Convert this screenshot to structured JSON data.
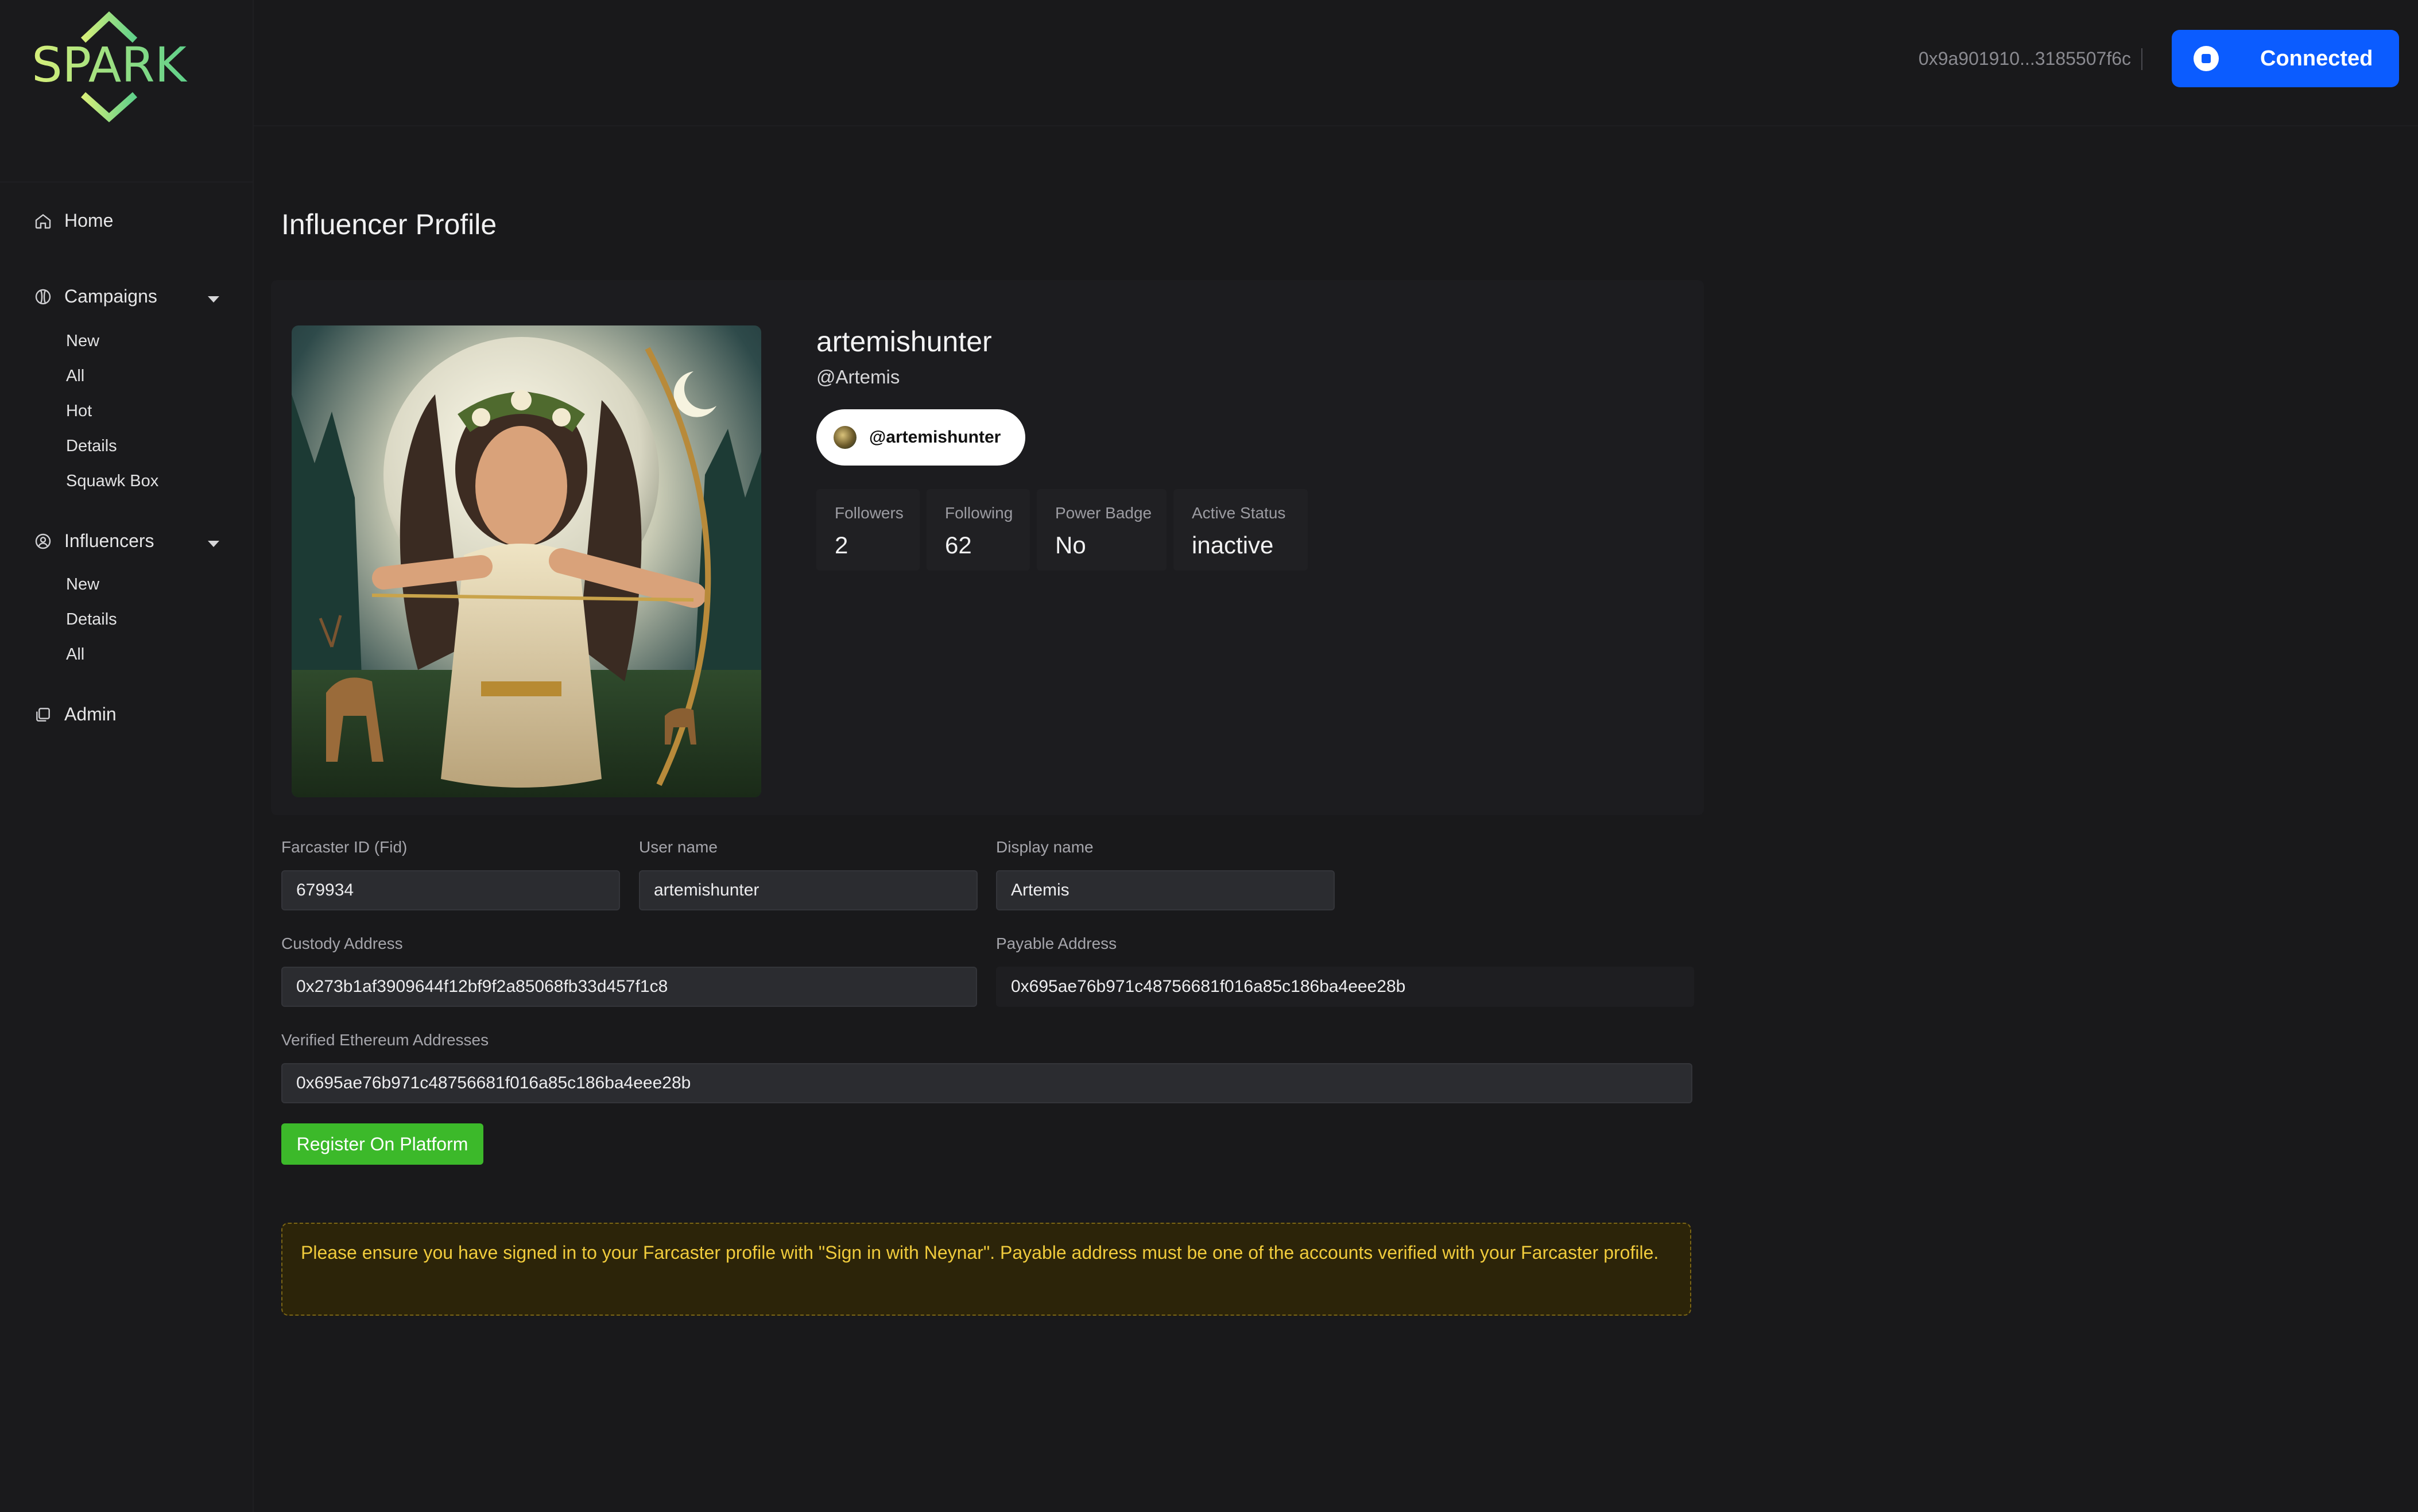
{
  "brand": {
    "name": "SPARK",
    "accent_color": "#8fdc6a"
  },
  "sidebar": {
    "home": {
      "label": "Home",
      "icon": "home-icon"
    },
    "campaigns": {
      "label": "Campaigns",
      "icon": "campaign-icon",
      "items": [
        "New",
        "All",
        "Hot",
        "Details",
        "Squawk Box"
      ]
    },
    "influencers": {
      "label": "Influencers",
      "icon": "user-circle-icon",
      "items": [
        "New",
        "Details",
        "All"
      ]
    },
    "admin": {
      "label": "Admin",
      "icon": "admin-icon"
    }
  },
  "header": {
    "wallet_address": "0x9a901910...3185507f6c",
    "connect_button": "Connected",
    "connect_color": "#0b5cff"
  },
  "page": {
    "title": "Influencer Profile"
  },
  "profile": {
    "username": "artemishunter",
    "handle": "@Artemis",
    "pill_label": "@artemishunter",
    "stats": [
      {
        "label": "Followers",
        "value": "2"
      },
      {
        "label": "Following",
        "value": "62"
      },
      {
        "label": "Power Badge",
        "value": "No"
      },
      {
        "label": "Active Status",
        "value": "inactive"
      }
    ]
  },
  "form": {
    "fid_label": "Farcaster ID (Fid)",
    "fid_value": "679934",
    "username_label": "User name",
    "username_value": "artemishunter",
    "display_label": "Display name",
    "display_value": "Artemis",
    "custody_label": "Custody Address",
    "custody_value": "0x273b1af3909644f12bf9f2a85068fb33d457f1c8",
    "payable_label": "Payable Address",
    "payable_value": "0x695ae76b971c48756681f016a85c186ba4eee28b",
    "verified_label": "Verified Ethereum Addresses",
    "verified_value": "0x695ae76b971c48756681f016a85c186ba4eee28b",
    "register_button": "Register On Platform",
    "register_color": "#3cb92a"
  },
  "notice": {
    "text": "Please ensure you have signed in to your Farcaster profile with \"Sign in with Neynar\". Payable address must be one of the accounts verified with your Farcaster profile.",
    "color": "#f0cb3c"
  }
}
